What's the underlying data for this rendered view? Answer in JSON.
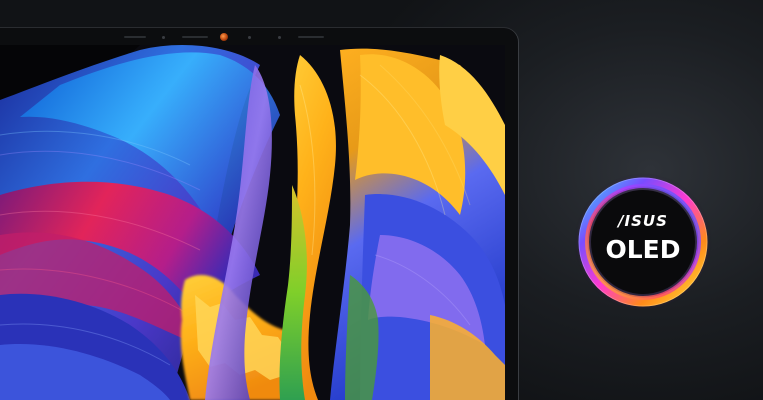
{
  "badge": {
    "brand": "/ISUS",
    "label": "OLED"
  },
  "colors": {
    "background": "#15171b",
    "bezel": "#0c0d0f",
    "camera": "#d4661e"
  },
  "icons": [
    "camera-lens",
    "oled-ring-badge"
  ]
}
